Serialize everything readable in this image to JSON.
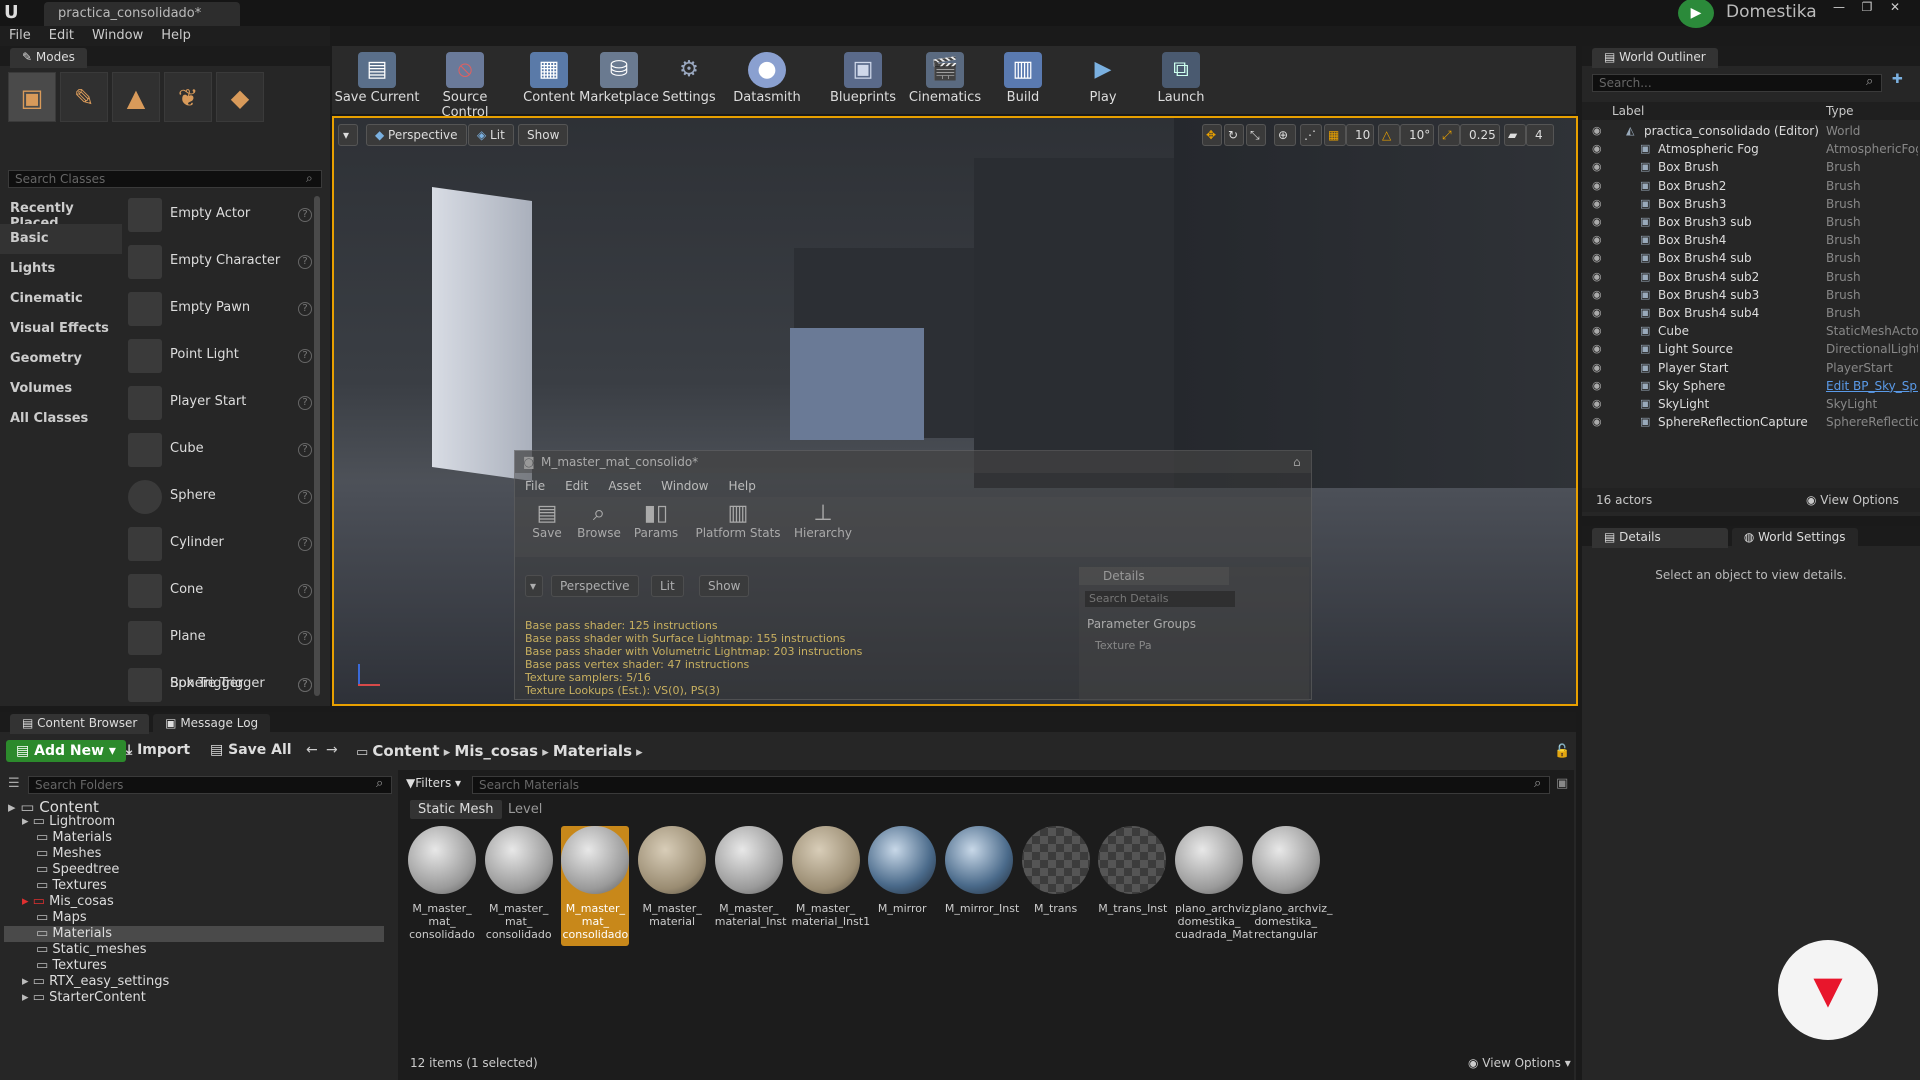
{
  "titlebar": {
    "tab": "practica_consolidado*",
    "brand": "Domestika"
  },
  "menu": [
    "File",
    "Edit",
    "Window",
    "Help"
  ],
  "modes": {
    "title": "Modes",
    "search_placeholder": "Search Classes",
    "categories": [
      "Recently Placed",
      "Basic",
      "Lights",
      "Cinematic",
      "Visual Effects",
      "Geometry",
      "Volumes",
      "All Classes"
    ],
    "selected_category": "Basic",
    "items": [
      "Empty Actor",
      "Empty Character",
      "Empty Pawn",
      "Point Light",
      "Player Start",
      "Cube",
      "Sphere",
      "Cylinder",
      "Cone",
      "Plane",
      "Box Trigger",
      "Sphere Trigger"
    ]
  },
  "toolbar": [
    {
      "label": "Save Current",
      "icon": "save-icon"
    },
    {
      "label": "Source Control",
      "icon": "source-control-icon"
    },
    {
      "label": "Content",
      "icon": "content-icon"
    },
    {
      "label": "Marketplace",
      "icon": "marketplace-icon"
    },
    {
      "label": "Settings",
      "icon": "settings-icon"
    },
    {
      "label": "Datasmith",
      "icon": "datasmith-icon"
    },
    {
      "label": "Blueprints",
      "icon": "blueprints-icon"
    },
    {
      "label": "Cinematics",
      "icon": "cinematics-icon"
    },
    {
      "label": "Build",
      "icon": "build-icon"
    },
    {
      "label": "Play",
      "icon": "play-icon"
    },
    {
      "label": "Launch",
      "icon": "launch-icon"
    }
  ],
  "viewport": {
    "perspective": "Perspective",
    "lit": "Lit",
    "show": "Show",
    "grid_snap": "10",
    "rot_snap": "10°",
    "scale_snap": "0.25",
    "camera_speed": "4"
  },
  "material_editor": {
    "title": "M_master_mat_consolido*",
    "menu": [
      "File",
      "Edit",
      "Asset",
      "Window",
      "Help"
    ],
    "tools": [
      "Save",
      "Browse",
      "Params",
      "Platform Stats",
      "Hierarchy"
    ],
    "perspective": "Perspective",
    "lit": "Lit",
    "show": "Show",
    "stats": [
      "Base pass shader: 125 instructions",
      "Base pass shader with Surface Lightmap: 155 instructions",
      "Base pass shader with Volumetric Lightmap: 203 instructions",
      "Base pass vertex shader: 47 instructions",
      "Texture samplers: 5/16",
      "Texture Lookups (Est.): VS(0), PS(3)"
    ],
    "details_title": "Details",
    "details_search": "Search Details",
    "param_groups": "Parameter Groups",
    "texture_pa": "Texture Pa"
  },
  "outliner": {
    "title": "World Outliner",
    "search_placeholder": "Search...",
    "col_label": "Label",
    "col_type": "Type",
    "items": [
      {
        "label": "practica_consolidado (Editor)",
        "type": "World"
      },
      {
        "label": "Atmospheric Fog",
        "type": "AtmosphericFog"
      },
      {
        "label": "Box Brush",
        "type": "Brush"
      },
      {
        "label": "Box Brush2",
        "type": "Brush"
      },
      {
        "label": "Box Brush3",
        "type": "Brush"
      },
      {
        "label": "Box Brush3 sub",
        "type": "Brush"
      },
      {
        "label": "Box Brush4",
        "type": "Brush"
      },
      {
        "label": "Box Brush4 sub",
        "type": "Brush"
      },
      {
        "label": "Box Brush4 sub2",
        "type": "Brush"
      },
      {
        "label": "Box Brush4 sub3",
        "type": "Brush"
      },
      {
        "label": "Box Brush4 sub4",
        "type": "Brush"
      },
      {
        "label": "Cube",
        "type": "StaticMeshActor"
      },
      {
        "label": "Light Source",
        "type": "DirectionalLight"
      },
      {
        "label": "Player Start",
        "type": "PlayerStart"
      },
      {
        "label": "Sky Sphere",
        "type": "Edit BP_Sky_Sphere"
      },
      {
        "label": "SkyLight",
        "type": "SkyLight"
      },
      {
        "label": "SphereReflectionCapture",
        "type": "SphereReflectionCapture"
      }
    ],
    "actor_count": "16 actors",
    "view_options": "View Options"
  },
  "details": {
    "tab_details": "Details",
    "tab_world": "World Settings",
    "empty_msg": "Select an object to view details."
  },
  "content_browser": {
    "tab": "Content Browser",
    "tab_log": "Message Log",
    "add_new": "Add New",
    "import": "Import",
    "save_all": "Save All",
    "breadcrumb": [
      "Content",
      "Mis_cosas",
      "Materials"
    ],
    "folder_search": "Search Folders",
    "filters": "Filters",
    "asset_search": "Search Materials",
    "filter_tags": [
      "Static Mesh",
      "Level"
    ],
    "tree": [
      {
        "name": "Content",
        "depth": 0
      },
      {
        "name": "Lightroom",
        "depth": 1
      },
      {
        "name": "Materials",
        "depth": 2
      },
      {
        "name": "Meshes",
        "depth": 2
      },
      {
        "name": "Speedtree",
        "depth": 2
      },
      {
        "name": "Textures",
        "depth": 2
      },
      {
        "name": "Mis_cosas",
        "depth": 1
      },
      {
        "name": "Maps",
        "depth": 2
      },
      {
        "name": "Materials",
        "depth": 2
      },
      {
        "name": "Static_meshes",
        "depth": 2
      },
      {
        "name": "Textures",
        "depth": 2
      },
      {
        "name": "RTX_easy_settings",
        "depth": 1
      },
      {
        "name": "StarterContent",
        "depth": 1
      }
    ],
    "assets": [
      "M_master_ mat_ consolidado",
      "M_master_ mat_ consolidado",
      "M_master_ mat_ consolidado",
      "M_master_ material",
      "M_master_ material_Inst",
      "M_master_ material_Inst1",
      "M_mirror",
      "M_mirror_Inst",
      "M_trans",
      "M_trans_Inst",
      "plano_archviz_ domestika_ cuadrada_Mat",
      "plano_archviz_ domestika_ rectangular"
    ],
    "status": "12 items (1 selected)",
    "view_options": "View Options"
  },
  "colors": {
    "accent": "#e8a000",
    "green": "#2c8a2c",
    "selected": "#c8881a",
    "domestika": "#e8162c"
  }
}
